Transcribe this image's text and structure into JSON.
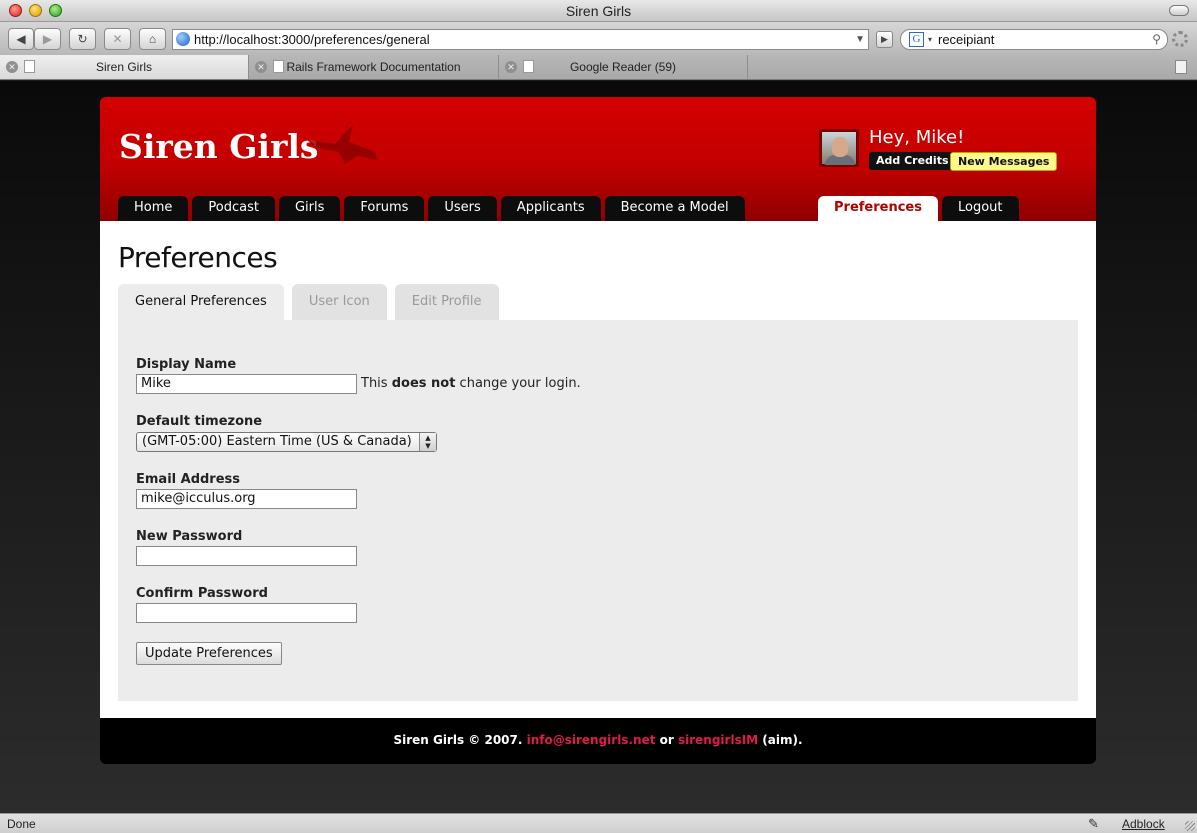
{
  "window": {
    "title": "Siren Girls"
  },
  "browser": {
    "url": "http://localhost:3000/preferences/general",
    "search_value": "receipiant",
    "tabs": [
      {
        "label": "Siren Girls",
        "active": true
      },
      {
        "label": "Rails Framework Documentation",
        "active": false
      },
      {
        "label": "Google Reader (59)",
        "active": false
      }
    ],
    "nav_glyphs": {
      "back": "◀",
      "forward": "▶",
      "reload": "↻",
      "stop": "✕",
      "home": "⌂",
      "go": "▶",
      "dropdown": "▼",
      "search_engine": "G",
      "search_arrow": "▾",
      "magnifier": "⚲"
    },
    "status": "Done",
    "adblock": "Adblock"
  },
  "site": {
    "logo": "Siren Girls",
    "greeting": "Hey, Mike!",
    "add_credits": "Add Credits",
    "new_messages": "New Messages",
    "nav": [
      "Home",
      "Podcast",
      "Girls",
      "Forums",
      "Users",
      "Applicants",
      "Become a Model"
    ],
    "nav_right": [
      {
        "label": "Preferences",
        "active": true
      },
      {
        "label": "Logout",
        "active": false
      }
    ],
    "accent": "#cc0000"
  },
  "page": {
    "title": "Preferences",
    "tabs": [
      {
        "label": "General Preferences",
        "active": true
      },
      {
        "label": "User Icon",
        "active": false
      },
      {
        "label": "Edit Profile",
        "active": false
      }
    ]
  },
  "form": {
    "display_name": {
      "label": "Display Name",
      "value": "Mike",
      "hint_before": "This ",
      "hint_bold": "does not",
      "hint_after": " change your login."
    },
    "timezone": {
      "label": "Default timezone",
      "value": "(GMT-05:00) Eastern Time (US & Canada)"
    },
    "email": {
      "label": "Email Address",
      "value": "mike@icculus.org"
    },
    "new_password": {
      "label": "New Password",
      "value": ""
    },
    "confirm_password": {
      "label": "Confirm Password",
      "value": ""
    },
    "submit": "Update Preferences"
  },
  "footer": {
    "text_before": "Siren Girls © 2007. ",
    "email": "info@sirengirls.net",
    "or": " or ",
    "aim": "sirengirlsIM",
    "after": " (aim)."
  }
}
